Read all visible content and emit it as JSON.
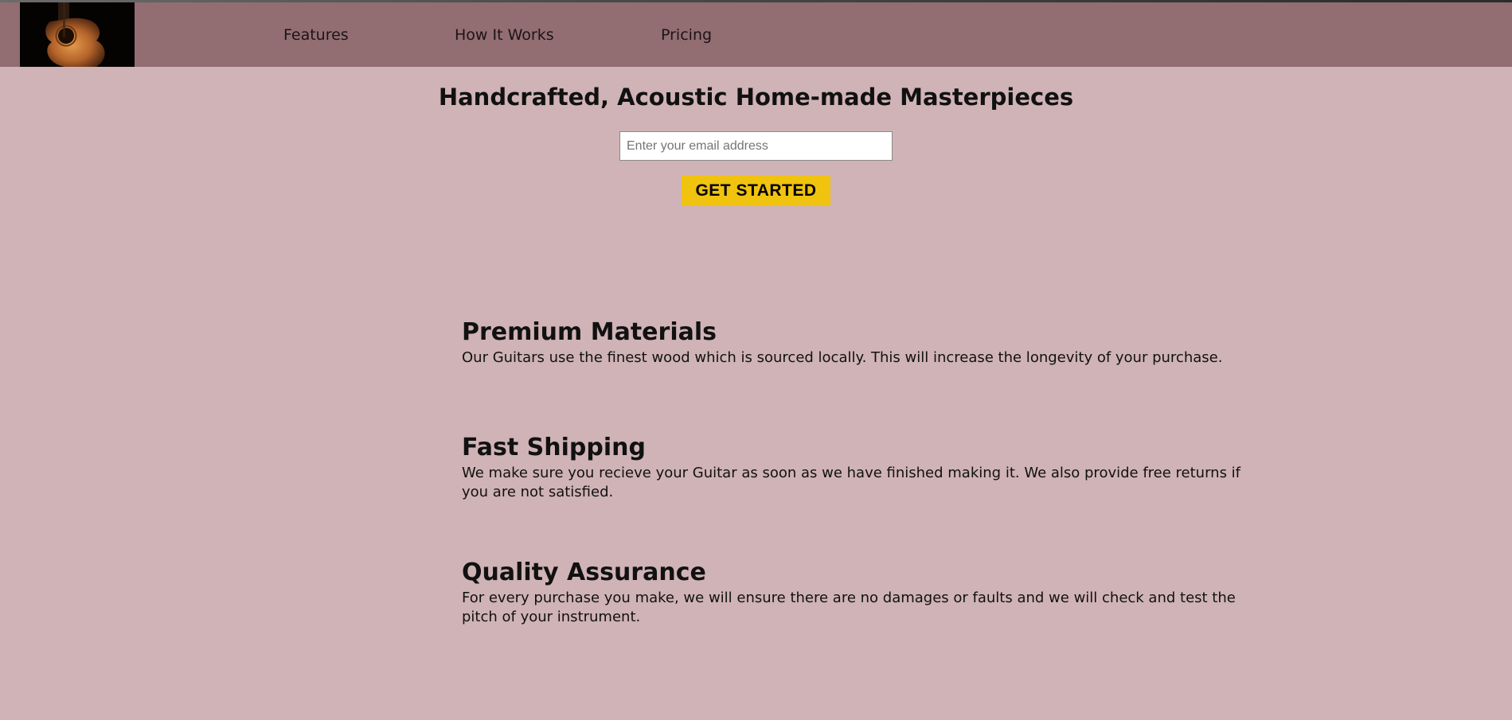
{
  "nav": {
    "logo_alt": "Acoustic guitar logo",
    "links": [
      {
        "label": "Features"
      },
      {
        "label": "How It Works"
      },
      {
        "label": "Pricing"
      }
    ]
  },
  "hero": {
    "title": "Handcrafted, Acoustic Home-made Masterpieces",
    "email_placeholder": "Enter your email address",
    "email_value": "",
    "cta_label": "GET STARTED"
  },
  "features": [
    {
      "title": "Premium Materials",
      "text": "Our Guitars use the finest wood which is sourced locally. This will increase the longevity of your purchase."
    },
    {
      "title": "Fast Shipping",
      "text": "We make sure you recieve your Guitar as soon as we have finished making it. We also provide free returns if you are not satisfied."
    },
    {
      "title": "Quality Assurance",
      "text": "For every purchase you make, we will ensure there are no damages or faults and we will check and test the pitch of your instrument."
    }
  ],
  "colors": {
    "page_background": "#d0b3b6",
    "navbar_background": "#926d71",
    "button_background": "#f0c30f"
  },
  "icons": {
    "logo": "guitar-logo-icon"
  }
}
